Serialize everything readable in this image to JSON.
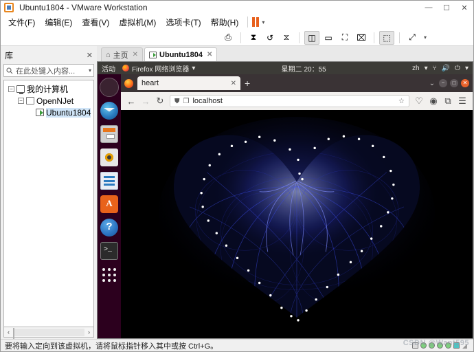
{
  "window": {
    "title": "Ubuntu1804 - VMware Workstation",
    "logo_icon": "vmware-logo-icon",
    "controls": [
      {
        "name": "minimize",
        "glyph": "—"
      },
      {
        "name": "maximize",
        "glyph": "☐"
      },
      {
        "name": "close",
        "glyph": "✕"
      }
    ]
  },
  "menubar": {
    "items": [
      {
        "label": "文件(F)"
      },
      {
        "label": "编辑(E)"
      },
      {
        "label": "查看(V)"
      },
      {
        "label": "虚拟机(M)"
      },
      {
        "label": "选项卡(T)"
      },
      {
        "label": "帮助(H)"
      }
    ],
    "pause_caret": "▾"
  },
  "toolbar": {
    "buttons": [
      {
        "name": "power-pause-button",
        "glyph": "❚❚"
      },
      {
        "name": "power-dropdown",
        "glyph": "▾"
      },
      {
        "name": "snapshot-manager-button",
        "glyph": "⎙"
      },
      {
        "name": "take-snapshot-button",
        "glyph": "⧗"
      },
      {
        "name": "revert-snapshot-button",
        "glyph": "↺"
      },
      {
        "name": "manage-snapshots-button",
        "glyph": "⧖"
      },
      {
        "name": "show-library-button",
        "glyph": "◫"
      },
      {
        "name": "show-thumbnail-bar-button",
        "glyph": "▭"
      },
      {
        "name": "full-screen-button",
        "glyph": "⛶"
      },
      {
        "name": "unity-mode-button",
        "glyph": "⌧"
      },
      {
        "name": "console-view-button",
        "glyph": "⬚"
      },
      {
        "name": "stretch-guest-button",
        "glyph": "⤢"
      },
      {
        "name": "stretch-dropdown",
        "glyph": "▾"
      }
    ]
  },
  "library": {
    "title": "库",
    "close_glyph": "✕",
    "search": {
      "placeholder": "在此处键入内容...",
      "value": "",
      "icon": "search-icon",
      "dropdown_glyph": "▾"
    },
    "tree": [
      {
        "label": "我的计算机",
        "level": 1,
        "expander": "−",
        "icon": "computer-icon",
        "selected": false
      },
      {
        "label": "OpenNJet",
        "level": 2,
        "expander": "−",
        "icon": "folder-icon",
        "selected": false
      },
      {
        "label": "Ubuntu1804",
        "level": 3,
        "expander": "",
        "icon": "vm-icon",
        "selected": true
      }
    ],
    "scrollbar": {
      "left_glyph": "‹",
      "right_glyph": "›"
    }
  },
  "tabs": [
    {
      "label": "主页",
      "icon": "home-icon",
      "active": false,
      "close_glyph": "✕"
    },
    {
      "label": "Ubuntu1804",
      "icon": "vm-icon",
      "active": true,
      "close_glyph": "✕"
    }
  ],
  "guest": {
    "topbar": {
      "activities": "活动",
      "app_name": "Firefox 网络浏览器",
      "app_caret": "▾",
      "clock": "星期二 20：55",
      "language": "zh",
      "language_caret": "▾",
      "icons": [
        {
          "name": "network-icon",
          "glyph": "⑂"
        },
        {
          "name": "volume-icon",
          "glyph": "🔊"
        },
        {
          "name": "power-icon",
          "glyph": "⏻"
        },
        {
          "name": "system-menu-caret-icon",
          "glyph": "▾"
        }
      ]
    },
    "dock": [
      {
        "name": "dock-firefox",
        "label": "Firefox",
        "selected": true
      },
      {
        "name": "dock-thunderbird",
        "label": "Thunderbird",
        "selected": false
      },
      {
        "name": "dock-files",
        "label": "Files",
        "selected": false
      },
      {
        "name": "dock-rhythmbox",
        "label": "Rhythmbox",
        "selected": false
      },
      {
        "name": "dock-libreoffice-writer",
        "label": "LibreOffice Writer",
        "selected": false
      },
      {
        "name": "dock-ubuntu-software",
        "label": "Ubuntu Software",
        "selected": false
      },
      {
        "name": "dock-help",
        "label": "Help",
        "selected": false
      },
      {
        "name": "dock-terminal",
        "label": "Terminal",
        "selected": false
      },
      {
        "name": "dock-show-applications",
        "label": "Show Applications",
        "selected": false
      }
    ],
    "firefox": {
      "tab": {
        "title": "heart",
        "close_glyph": "✕",
        "new_tab_glyph": "+",
        "list_all_tabs_glyph": "⌄"
      },
      "window_controls": [
        {
          "name": "minimize",
          "glyph": "−"
        },
        {
          "name": "maximize",
          "glyph": "□"
        },
        {
          "name": "close",
          "glyph": "✕"
        }
      ],
      "nav": {
        "back_glyph": "←",
        "forward_glyph": "→",
        "reload_glyph": "↻",
        "shield_glyph": "⛊",
        "page_glyph": "❐",
        "url": "localhost",
        "bookmark_glyph": "☆",
        "pocket_glyph": "♡",
        "account_glyph": "◉",
        "save_glyph": "⧉",
        "menu_glyph": "☰"
      },
      "page": {
        "title": "heart",
        "background_color": "#000000",
        "particle_color": "#2b36c8",
        "dot_color": "#ffffff"
      }
    }
  },
  "statusbar": {
    "message": "要将输入定向到该虚拟机，请将鼠标指针移入其中或按 Ctrl+G。",
    "watermark": "CSDN @Want595",
    "grip_glyph": "◢"
  }
}
